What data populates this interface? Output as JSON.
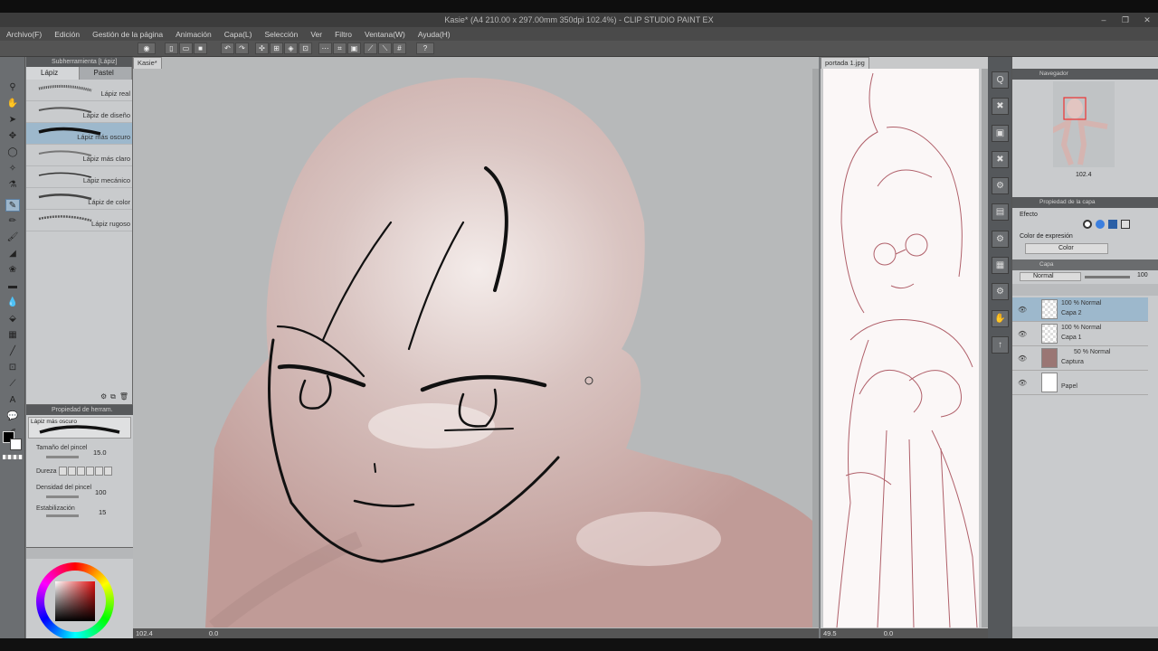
{
  "window": {
    "title": "Kasie* (A4 210.00 x 297.00mm 350dpi 102.4%) - CLIP STUDIO PAINT EX"
  },
  "menu": [
    "Archivo(F)",
    "Edición",
    "Gestión de la página",
    "Animación",
    "Capa(L)",
    "Selección",
    "Ver",
    "Filtro",
    "Ventana(W)",
    "Ayuda(H)"
  ],
  "subtool": {
    "title": "Subherramienta [Lápiz]",
    "tabs": [
      "Lápiz",
      "Pastel"
    ],
    "brushes": [
      "Lápiz real",
      "Lápiz de diseño",
      "Lápiz más oscuro",
      "Lápiz más claro",
      "Lápiz mecánico",
      "Lápiz de color",
      "Lápiz rugoso"
    ],
    "selected_index": 2
  },
  "tool_property": {
    "title": "Propiedad de herram. [Lápiz]",
    "brush_name": "Lápiz más oscuro",
    "brush_size_label": "Tamaño del pincel",
    "brush_size_value": "15.0",
    "hardness_label": "Dureza",
    "density_label": "Densidad del pincel",
    "density_value": "100",
    "stabilization_label": "Estabilización",
    "stabilization_value": "15"
  },
  "canvas_left": {
    "tab": "Kasie*",
    "zoom": "102.4",
    "angle": "0.0"
  },
  "canvas_right": {
    "tab": "portada 1.jpg",
    "zoom": "49.5",
    "angle": "0.0"
  },
  "navigator": {
    "title": "Navegador",
    "zoom": "102.4"
  },
  "layer_property": {
    "title": "Propiedad de la capa",
    "effect_label": "Efecto",
    "expression_label": "Color de expresión",
    "expression_value": "Color"
  },
  "layers_panel": {
    "tab": "Capa",
    "blend_mode": "Normal",
    "opacity": "100",
    "layers": [
      {
        "line1": "100 % Normal",
        "line2": "Capa 2",
        "selected": true
      },
      {
        "line1": "100 % Normal",
        "line2": "Capa 1",
        "selected": false
      },
      {
        "line1": "50 % Normal",
        "line2": "Captura",
        "selected": false
      },
      {
        "line1": "",
        "line2": "Papel",
        "selected": false
      }
    ]
  },
  "colors": {
    "accent": "#9db8cc",
    "skin": "#d4b9b6",
    "sketch_line": "#b0606a"
  }
}
